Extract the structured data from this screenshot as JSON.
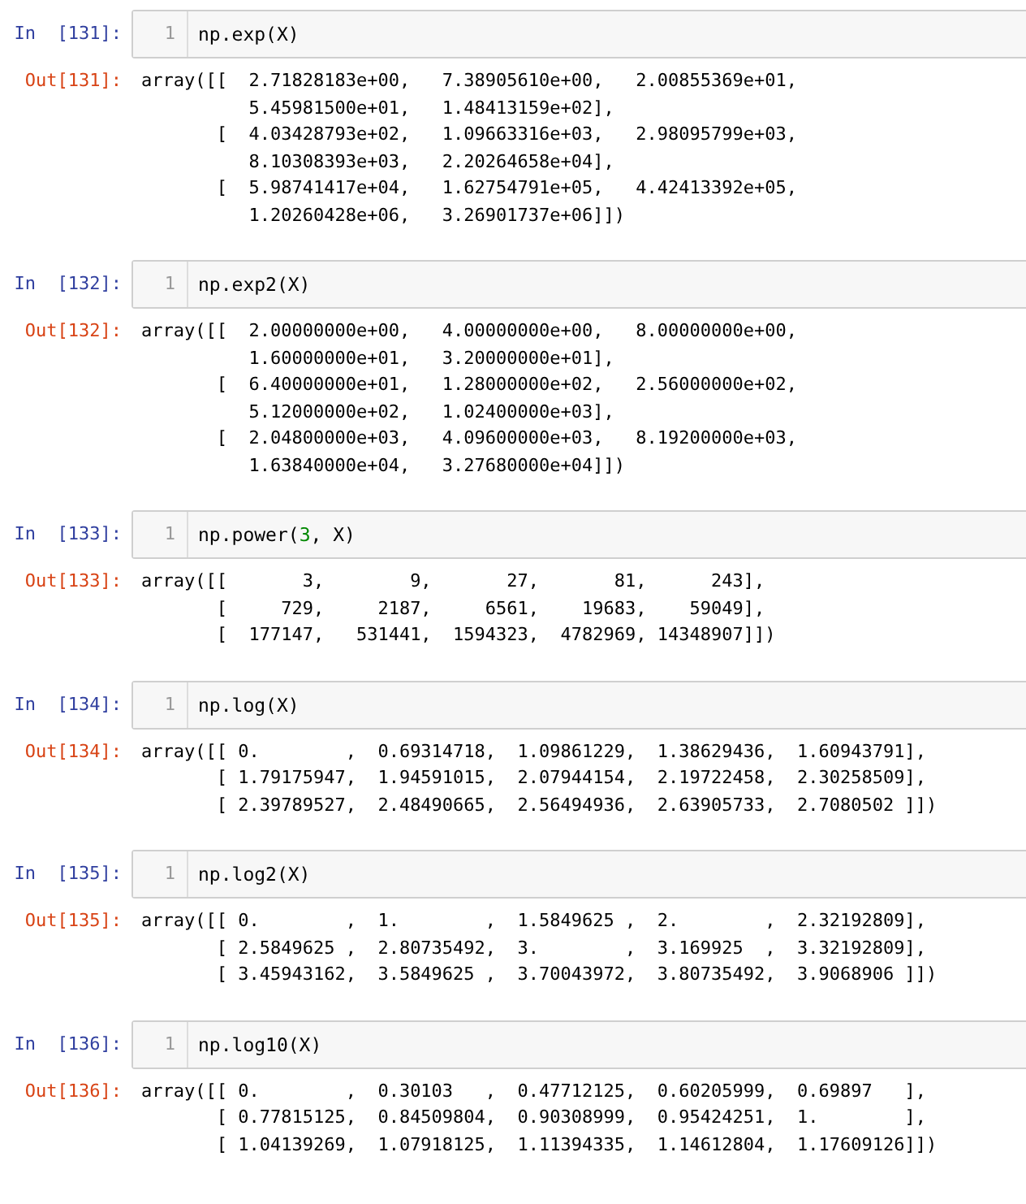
{
  "cells": [
    {
      "input_prompt": "In  [131]:",
      "line_number": "1",
      "code": [
        {
          "kind": "plain",
          "text": "np.exp(X)"
        }
      ],
      "output_prompt": "Out[131]:",
      "output": [
        "array([[  2.71828183e+00,   7.38905610e+00,   2.00855369e+01,",
        "          5.45981500e+01,   1.48413159e+02],",
        "       [  4.03428793e+02,   1.09663316e+03,   2.98095799e+03,",
        "          8.10308393e+03,   2.20264658e+04],",
        "       [  5.98741417e+04,   1.62754791e+05,   4.42413392e+05,",
        "          1.20260428e+06,   3.26901737e+06]])"
      ]
    },
    {
      "input_prompt": "In  [132]:",
      "line_number": "1",
      "code": [
        {
          "kind": "plain",
          "text": "np.exp2(X)"
        }
      ],
      "output_prompt": "Out[132]:",
      "output": [
        "array([[  2.00000000e+00,   4.00000000e+00,   8.00000000e+00,",
        "          1.60000000e+01,   3.20000000e+01],",
        "       [  6.40000000e+01,   1.28000000e+02,   2.56000000e+02,",
        "          5.12000000e+02,   1.02400000e+03],",
        "       [  2.04800000e+03,   4.09600000e+03,   8.19200000e+03,",
        "          1.63840000e+04,   3.27680000e+04]])"
      ]
    },
    {
      "input_prompt": "In  [133]:",
      "line_number": "1",
      "code": [
        {
          "kind": "plain",
          "text": "np.power("
        },
        {
          "kind": "number",
          "text": "3"
        },
        {
          "kind": "plain",
          "text": ", X)"
        }
      ],
      "output_prompt": "Out[133]:",
      "output": [
        "array([[       3,        9,       27,       81,      243],",
        "       [     729,     2187,     6561,    19683,    59049],",
        "       [  177147,   531441,  1594323,  4782969, 14348907]])"
      ]
    },
    {
      "input_prompt": "In  [134]:",
      "line_number": "1",
      "code": [
        {
          "kind": "plain",
          "text": "np.log(X)"
        }
      ],
      "output_prompt": "Out[134]:",
      "output": [
        "array([[ 0.        ,  0.69314718,  1.09861229,  1.38629436,  1.60943791],",
        "       [ 1.79175947,  1.94591015,  2.07944154,  2.19722458,  2.30258509],",
        "       [ 2.39789527,  2.48490665,  2.56494936,  2.63905733,  2.7080502 ]])"
      ]
    },
    {
      "input_prompt": "In  [135]:",
      "line_number": "1",
      "code": [
        {
          "kind": "plain",
          "text": "np.log2(X)"
        }
      ],
      "output_prompt": "Out[135]:",
      "output": [
        "array([[ 0.        ,  1.        ,  1.5849625 ,  2.        ,  2.32192809],",
        "       [ 2.5849625 ,  2.80735492,  3.        ,  3.169925  ,  3.32192809],",
        "       [ 3.45943162,  3.5849625 ,  3.70043972,  3.80735492,  3.9068906 ]])"
      ]
    },
    {
      "input_prompt": "In  [136]:",
      "line_number": "1",
      "code": [
        {
          "kind": "plain",
          "text": "np.log10(X)"
        }
      ],
      "output_prompt": "Out[136]:",
      "output": [
        "array([[ 0.        ,  0.30103   ,  0.47712125,  0.60205999,  0.69897   ],",
        "       [ 0.77815125,  0.84509804,  0.90308999,  0.95424251,  1.        ],",
        "       [ 1.04139269,  1.07918125,  1.11394335,  1.14612804,  1.17609126]])"
      ]
    }
  ]
}
